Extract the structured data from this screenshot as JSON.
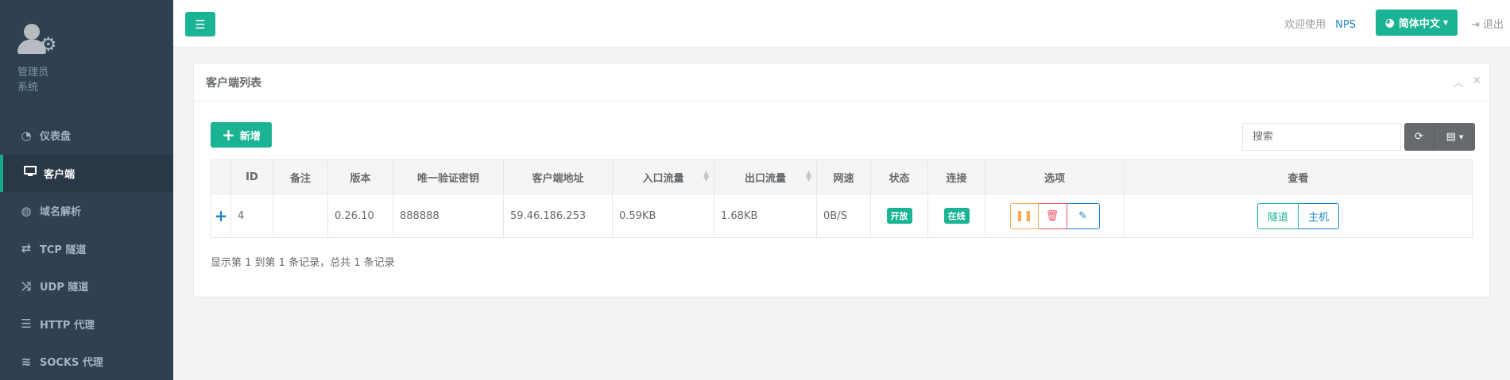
{
  "sidebar": {
    "profile": {
      "name": "管理员",
      "role": "系统"
    },
    "items": [
      {
        "label": "仪表盘",
        "icon": "dashboard-icon",
        "glyph": "◔"
      },
      {
        "label": "客户端",
        "icon": "monitor-icon",
        "glyph": "▭"
      },
      {
        "label": "域名解析",
        "icon": "globe-icon",
        "glyph": "◍"
      },
      {
        "label": "TCP 隧道",
        "icon": "retweet-icon",
        "glyph": "⇄"
      },
      {
        "label": "UDP 隧道",
        "icon": "random-icon",
        "glyph": "⤨"
      },
      {
        "label": "HTTP 代理",
        "icon": "server-icon",
        "glyph": "☰"
      },
      {
        "label": "SOCKS 代理",
        "icon": "layers-icon",
        "glyph": "≋"
      }
    ],
    "active_index": 1
  },
  "topbar": {
    "welcome": "欢迎使用",
    "brand": "NPS",
    "language": "简体中文",
    "logout": "退出"
  },
  "panel": {
    "title": "客户端列表",
    "add_label": "新增",
    "search_placeholder": "搜索",
    "columns": [
      "ID",
      "备注",
      "版本",
      "唯一验证密钥",
      "客户端地址",
      "入口流量",
      "出口流量",
      "网速",
      "状态",
      "连接",
      "选项",
      "查看"
    ],
    "rows": [
      {
        "id": "4",
        "remark": "",
        "version": "0.26.10",
        "vkey": "888888",
        "address": "59.46.186.253",
        "in_flow": "0.59KB",
        "out_flow": "1.68KB",
        "speed": "0B/S",
        "status": "开放",
        "connection": "在线",
        "view_tunnel": "隧道",
        "view_host": "主机"
      }
    ],
    "pagination_info": "显示第 1 到第 1 条记录，总共 1 条记录"
  },
  "colors": {
    "primary": "#1ab394",
    "info": "#1c84c6",
    "warning": "#f8ac59",
    "danger": "#ed5565",
    "sidebar_bg": "#2f4050"
  }
}
